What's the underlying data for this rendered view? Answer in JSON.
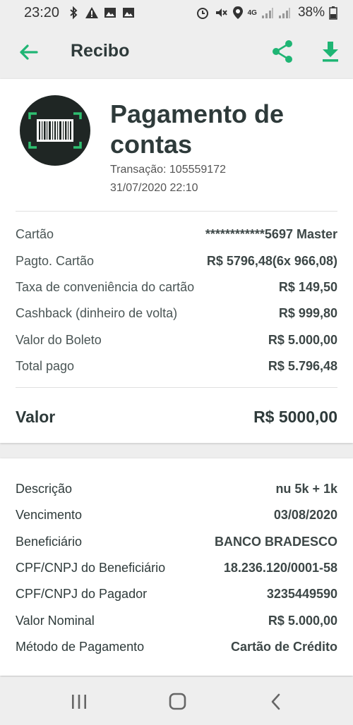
{
  "status_bar": {
    "time": "23:20",
    "network": "4G",
    "battery": "38%",
    "icons": [
      "bluetooth-icon",
      "warning-icon",
      "image-icon",
      "image-icon",
      "alarm-icon",
      "mute-icon",
      "location-icon",
      "signal-icon",
      "signal-icon",
      "battery-icon"
    ]
  },
  "app_bar": {
    "title": "Recibo",
    "accent_color": "#1fb574"
  },
  "receipt": {
    "heading": "Pagamento de contas",
    "transaction": "Transação: 105559172",
    "datetime": "31/07/2020 22:10",
    "rows": [
      {
        "label": "Cartão",
        "value": "************5697 Master"
      },
      {
        "label": "Pagto. Cartão",
        "value": "R$ 5796,48(6x 966,08)"
      },
      {
        "label": "Taxa de conveniência do cartão",
        "value": "R$ 149,50"
      },
      {
        "label": "Cashback (dinheiro de volta)",
        "value": "R$ 999,80"
      },
      {
        "label": "Valor do Boleto",
        "value": "R$ 5.000,00"
      },
      {
        "label": "Total pago",
        "value": "R$ 5.796,48"
      }
    ],
    "total": {
      "label": "Valor",
      "value": "R$ 5000,00"
    }
  },
  "details": {
    "rows": [
      {
        "label": "Descrição",
        "value": "nu 5k + 1k"
      },
      {
        "label": "Vencimento",
        "value": "03/08/2020"
      },
      {
        "label": "Beneficiário",
        "value": "BANCO BRADESCO"
      },
      {
        "label": "CPF/CNPJ do Beneficiário",
        "value": "18.236.120/0001-58"
      },
      {
        "label": "CPF/CNPJ do Pagador",
        "value": "3235449590"
      },
      {
        "label": "Valor Nominal",
        "value": "R$ 5.000,00"
      },
      {
        "label": "Método de Pagamento",
        "value": "Cartão de Crédito"
      }
    ]
  }
}
